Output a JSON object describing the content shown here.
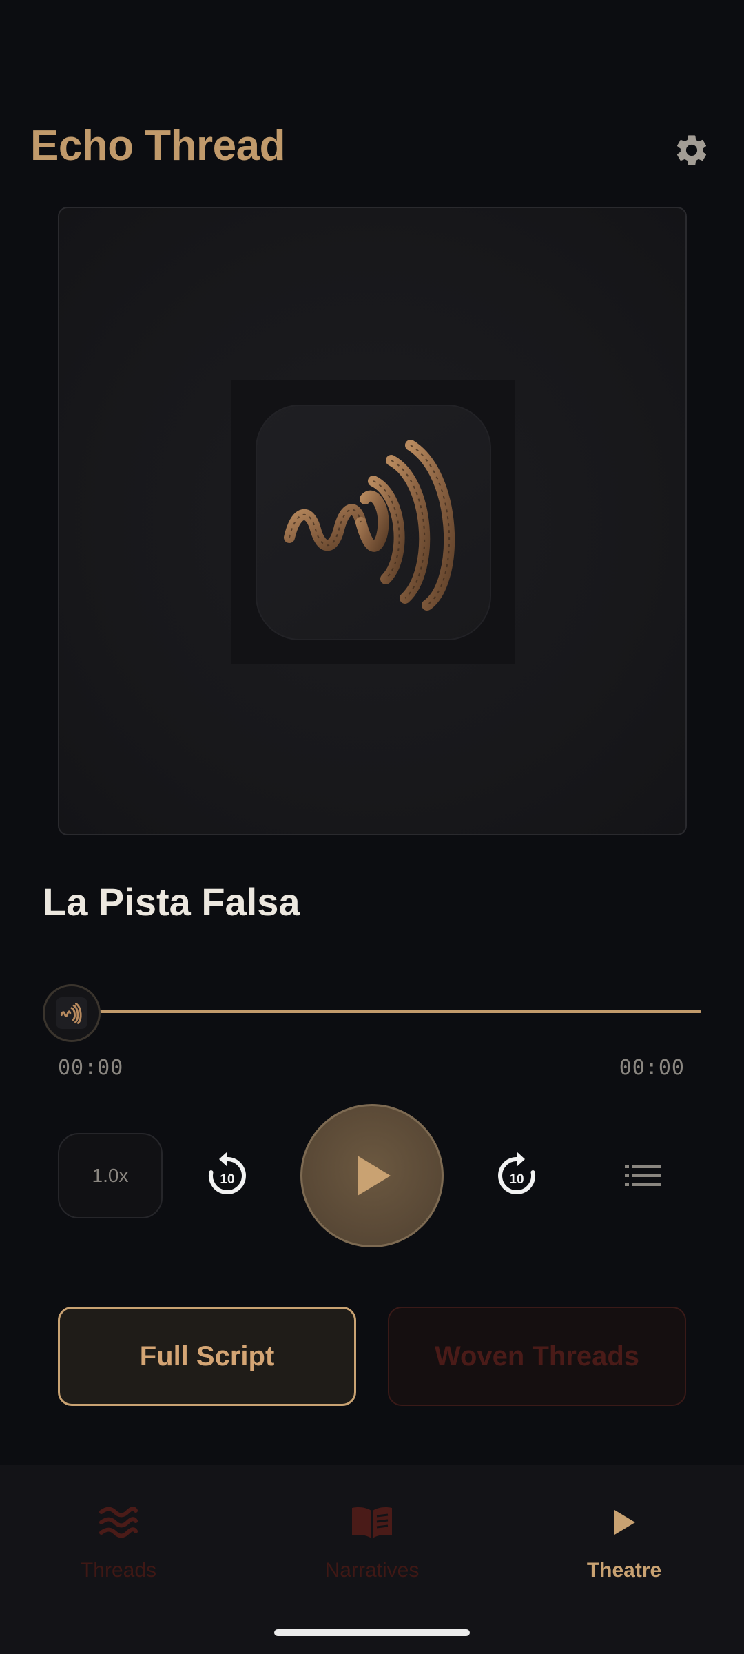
{
  "header": {
    "title": "Echo Thread",
    "settings_icon": "gear-icon"
  },
  "track": {
    "title": "La Pista Falsa"
  },
  "progress": {
    "elapsed": "00:00",
    "total": "00:00",
    "fraction": 0.0
  },
  "controls": {
    "speed_label": "1.0x",
    "skip_back_label": "10",
    "skip_forward_label": "10",
    "play_icon": "play-icon",
    "queue_icon": "list-icon"
  },
  "actions": {
    "full_script_label": "Full Script",
    "woven_threads_label": "Woven Threads"
  },
  "nav": {
    "items": [
      {
        "label": "Threads",
        "icon": "waves-icon",
        "active": false
      },
      {
        "label": "Narratives",
        "icon": "book-icon",
        "active": false
      },
      {
        "label": "Theatre",
        "icon": "play-icon",
        "active": true
      }
    ]
  },
  "colors": {
    "accent": "#c19a6b",
    "background": "#0c0d11",
    "inactive_nav": "#4a1b18",
    "play_button": "#5b4a37"
  }
}
